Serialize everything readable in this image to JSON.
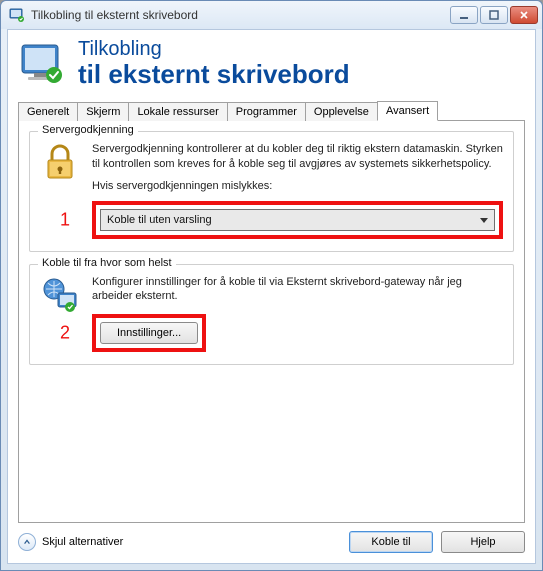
{
  "window": {
    "title": "Tilkobling til eksternt skrivebord"
  },
  "header": {
    "top": "Tilkobling",
    "main": "til eksternt skrivebord"
  },
  "tabs": [
    {
      "label": "Generelt"
    },
    {
      "label": "Skjerm"
    },
    {
      "label": "Lokale ressurser"
    },
    {
      "label": "Programmer"
    },
    {
      "label": "Opplevelse"
    },
    {
      "label": "Avansert"
    }
  ],
  "active_tab": "Avansert",
  "section1": {
    "legend": "Servergodkjenning",
    "description": "Servergodkjenning kontrollerer at du kobler deg til riktig ekstern datamaskin. Styrken til kontrollen som kreves for å koble seg til avgjøres av systemets sikkerhetspolicy.",
    "sub_label": "Hvis servergodkjenningen mislykkes:",
    "marker": "1",
    "dropdown_value": "Koble til uten varsling"
  },
  "section2": {
    "legend": "Koble til fra hvor som helst",
    "description": "Konfigurer innstillinger for å koble til via Eksternt skrivebord-gateway når jeg arbeider eksternt.",
    "marker": "2",
    "button_label": "Innstillinger..."
  },
  "footer": {
    "hide_options": "Skjul alternativer",
    "connect": "Koble til",
    "help": "Hjelp"
  }
}
